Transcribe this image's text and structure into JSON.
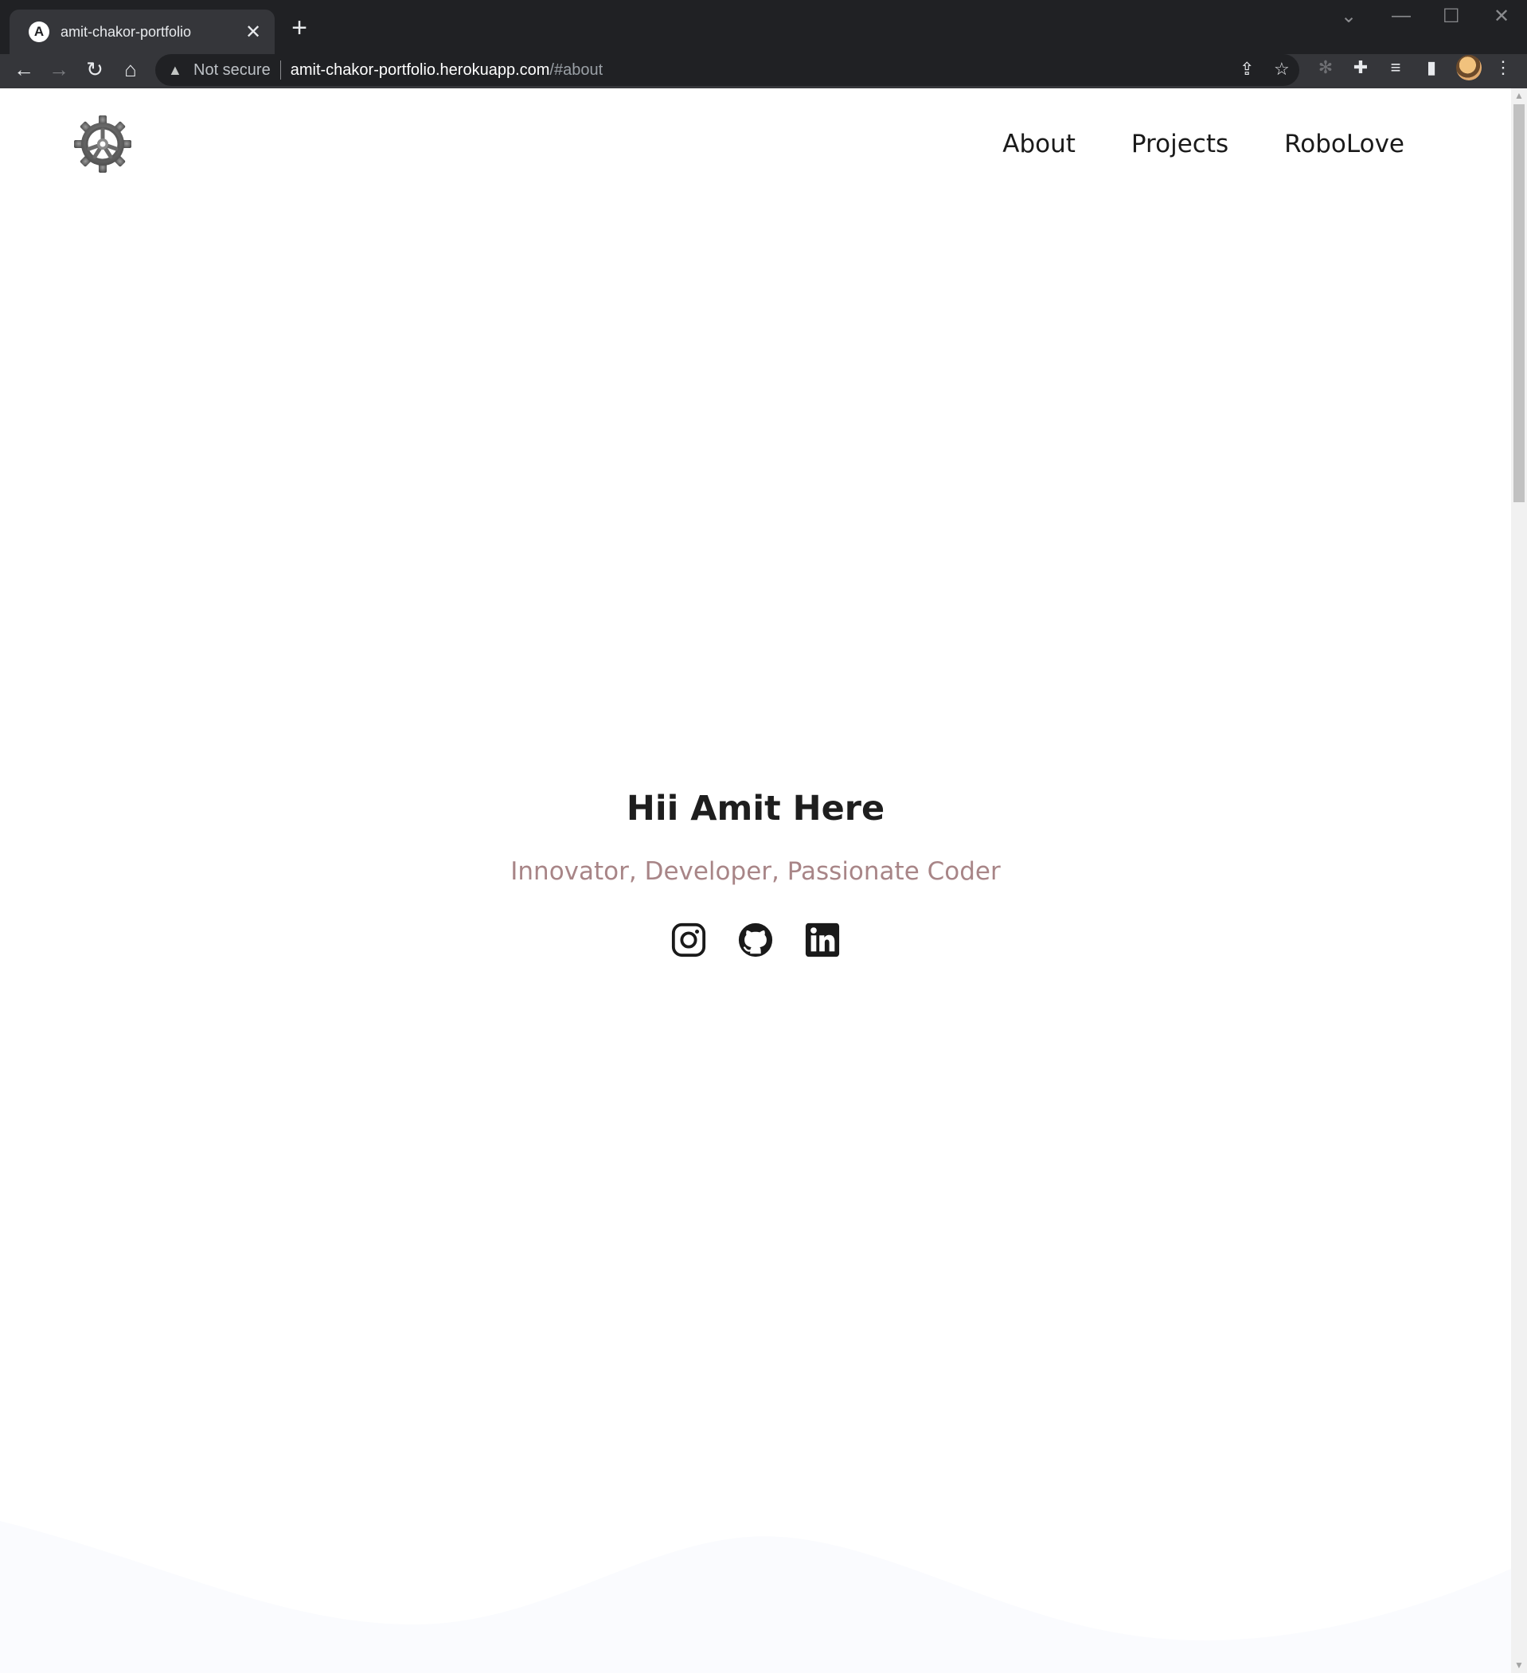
{
  "browser": {
    "tab_title": "amit-chakor-portfolio",
    "tab_favicon_letter": "A",
    "security_label": "Not secure",
    "url_host": "amit-chakor-portfolio.herokuapp.com",
    "url_path": "/#about"
  },
  "header": {
    "logo_icon": "gear-icon",
    "nav": [
      "About",
      "Projects",
      "RoboLove"
    ]
  },
  "hero": {
    "title": "Hii Amit Here",
    "subtitle": "Innovator, Developer, Passionate Coder",
    "subtitle_color": "#a88587",
    "socials": [
      "instagram-icon",
      "github-icon",
      "linkedin-icon"
    ]
  }
}
